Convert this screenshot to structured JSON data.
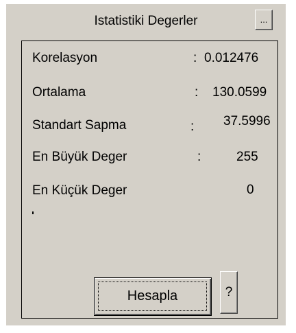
{
  "title": "Istatistiki Degerler",
  "stats": [
    {
      "label": "Korelasyon",
      "colon": ":",
      "value": "0.012476"
    },
    {
      "label": "Ortalama",
      "colon": ":",
      "value": "130.0599"
    },
    {
      "label": "Standart Sapma",
      "colon": ":",
      "value": "37.5996"
    },
    {
      "label": "En Büyük Deger",
      "colon": ":",
      "value": "255"
    },
    {
      "label": "En Küçük Deger",
      "colon": "",
      "value": "0"
    }
  ],
  "buttons": {
    "dots": "...",
    "calculate": "Hesapla",
    "help": "?"
  }
}
